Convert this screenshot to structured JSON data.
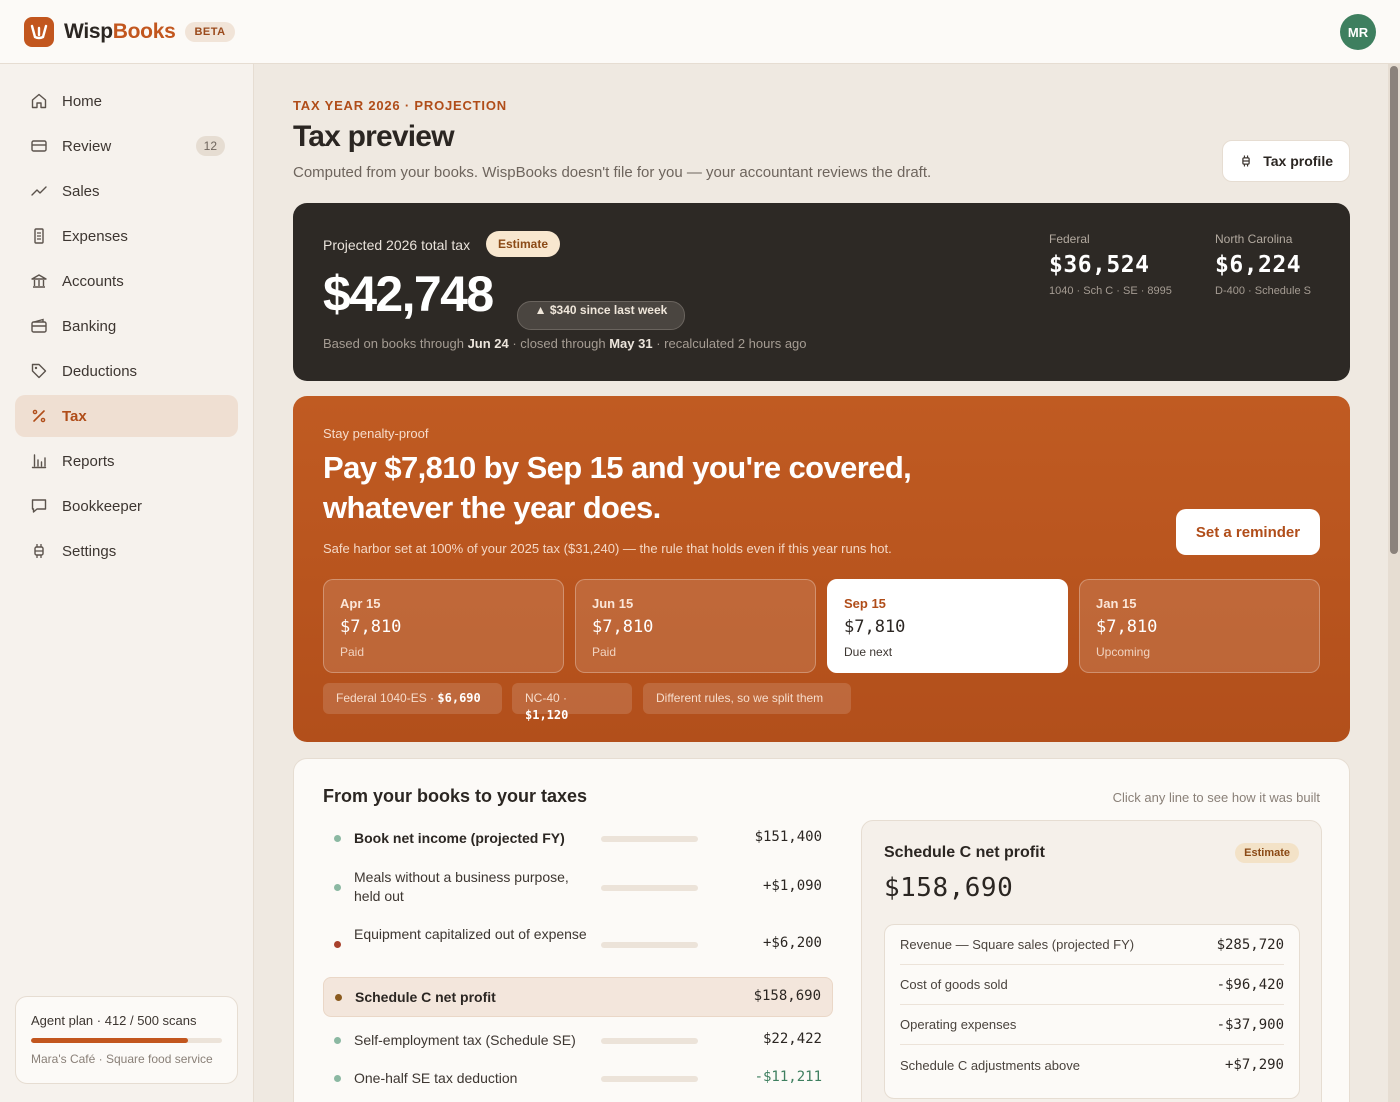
{
  "app": {
    "brand_first": "Wisp",
    "brand_second": "Books",
    "beta_label": "BETA",
    "avatar_initials": "MR",
    "accent_color": "#c2561e"
  },
  "sidebar": {
    "items": [
      {
        "label": "Home",
        "icon": "home-icon"
      },
      {
        "label": "Review",
        "icon": "inbox-icon",
        "badge": "12"
      },
      {
        "label": "Sales",
        "icon": "trend-up-icon"
      },
      {
        "label": "Expenses",
        "icon": "receipt-icon"
      },
      {
        "label": "Accounts",
        "icon": "bank-icon"
      },
      {
        "label": "Banking",
        "icon": "wallet-icon"
      },
      {
        "label": "Deductions",
        "icon": "tag-icon"
      },
      {
        "label": "Tax",
        "icon": "percent-icon",
        "active": true
      },
      {
        "label": "Reports",
        "icon": "bar-chart-icon"
      },
      {
        "label": "Bookkeeper",
        "icon": "chat-icon"
      },
      {
        "label": "Settings",
        "icon": "settings-icon"
      }
    ],
    "plan": {
      "title": "Agent plan · 412 / 500 scans",
      "usage_fraction": 0.824,
      "business": "Mara's Café · Square food service"
    }
  },
  "header": {
    "eyebrow": "TAX YEAR 2026 · PROJECTION",
    "title": "Tax preview",
    "subtitle": "Computed from your books. WispBooks doesn't file for you — your accountant reviews the draft.",
    "tax_profile_button": "Tax profile"
  },
  "summary": {
    "label": "Projected 2026 total tax",
    "estimate_pill": "Estimate",
    "amount": "$42,748",
    "delta": "▲ $340 since last week",
    "note_prefix": "Based on books through ",
    "note_books_date": "Jun 24",
    "note_mid": " · closed through ",
    "note_closed_date": "May 31",
    "note_suffix": " · recalculated 2 hours ago",
    "federal": {
      "label": "Federal",
      "amount": "$36,524",
      "detail": "1040 · Sch C · SE · 8995"
    },
    "state": {
      "label": "North Carolina",
      "amount": "$6,224",
      "detail": "D-400 · Schedule S"
    }
  },
  "safe_harbor": {
    "eyebrow": "Stay penalty-proof",
    "headline": "Pay $7,810 by Sep 15 and you're covered, whatever the year does.",
    "subtext": "Safe harbor set at 100% of your 2025 tax ($31,240) — the rule that holds even if this year runs hot.",
    "reminder_button": "Set a reminder",
    "installments": [
      {
        "date": "Apr 15",
        "amount": "$7,810",
        "status": "Paid"
      },
      {
        "date": "Jun 15",
        "amount": "$7,810",
        "status": "Paid"
      },
      {
        "date": "Sep 15",
        "amount": "$7,810",
        "status": "Due next"
      },
      {
        "date": "Jan 15",
        "amount": "$7,810",
        "status": "Upcoming"
      }
    ],
    "chips": {
      "federal_label": "Federal 1040-ES · ",
      "federal_value": "$6,690",
      "state_label": "NC-40 · ",
      "state_value": "$1,120",
      "note": "Different rules, so we split them"
    }
  },
  "books_to_taxes": {
    "title": "From your books to your taxes",
    "hint": "Click any line to see how it was built",
    "rows": [
      {
        "label": "Book net income (projected FY)",
        "value": "$151,400",
        "dot": "#8bb8a2",
        "bold": true
      },
      {
        "label": "Meals without a business purpose, held out",
        "value": "+$1,090",
        "dot": "#8bb8a2"
      },
      {
        "label": "Equipment capitalized out of expense",
        "value": "+$6,200",
        "dot": "#a8412c"
      },
      {
        "label": "Schedule C net profit",
        "value": "$158,690",
        "dot": "#8a5a1e",
        "bold": true,
        "highlight": true
      },
      {
        "label": "Self-employment tax (Schedule SE)",
        "value": "$22,422",
        "dot": "#8bb8a2"
      },
      {
        "label": "One-half SE tax deduction",
        "value": "-$11,211",
        "dot": "#8bb8a2",
        "negative": true
      }
    ],
    "schedule_c": {
      "title": "Schedule C net profit",
      "estimate_pill": "Estimate",
      "amount": "$158,690",
      "lines": [
        {
          "label": "Revenue — Square sales (projected FY)",
          "value": "$285,720"
        },
        {
          "label": "Cost of goods sold",
          "value": "-$96,420"
        },
        {
          "label": "Operating expenses",
          "value": "-$37,900"
        },
        {
          "label": "Schedule C adjustments above",
          "value": "+$7,290"
        }
      ]
    }
  }
}
